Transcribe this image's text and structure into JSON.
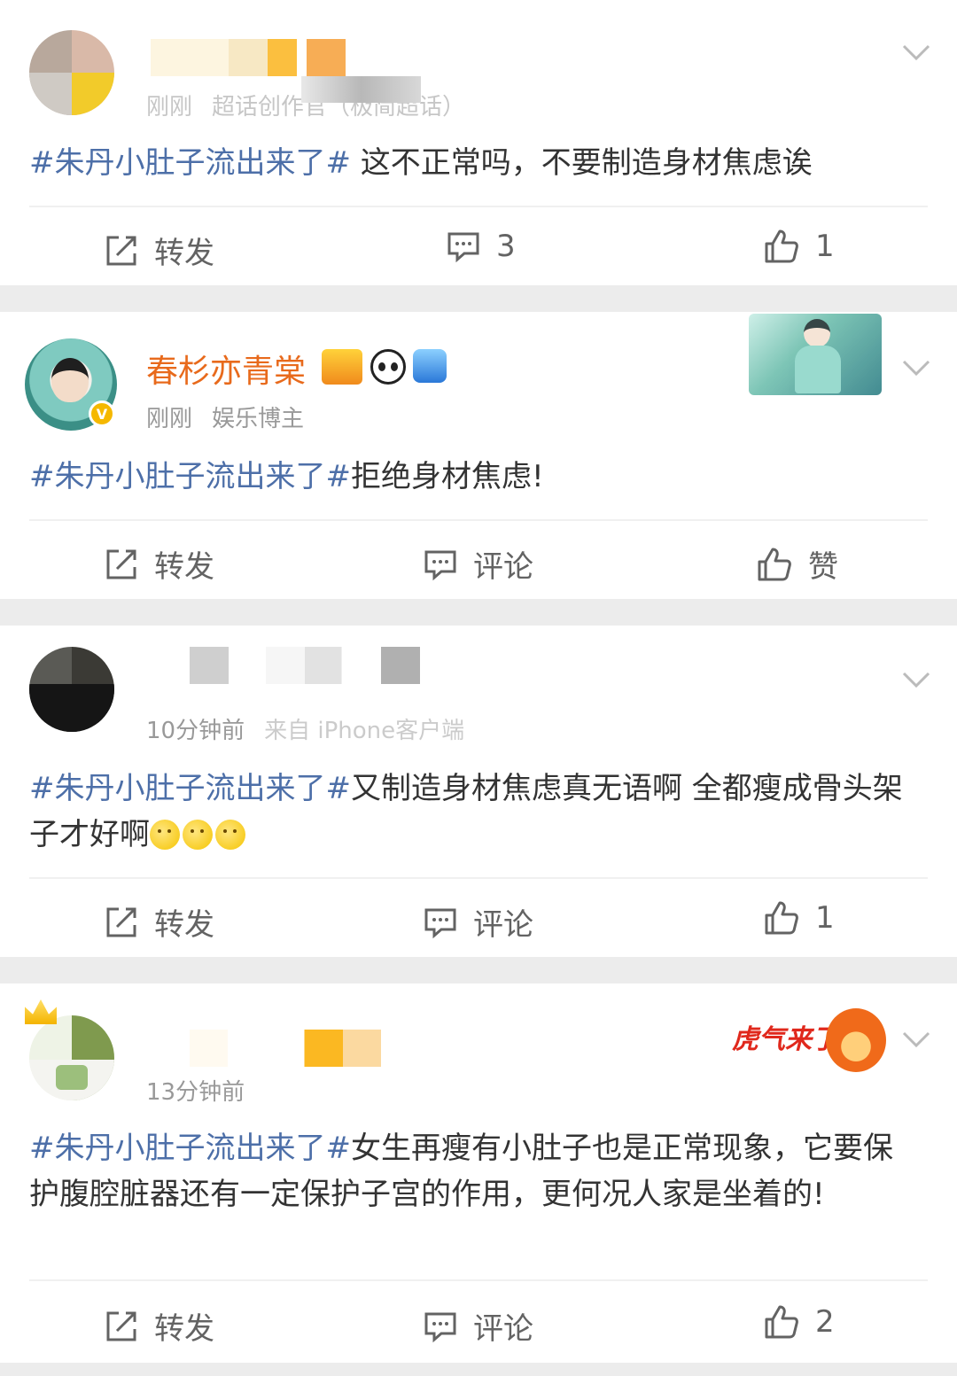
{
  "posts": [
    {
      "time": "刚刚",
      "source": "超话创作官（极简超话）",
      "topic": "#朱丹小肚子流出来了#",
      "text": " 这不正常吗，不要制造身材焦虑诶",
      "repost_label": "转发",
      "comment_label": "3",
      "like_label": "1"
    },
    {
      "username": "春杉亦青棠",
      "time": "刚刚",
      "source": "娱乐博主",
      "topic": "#朱丹小肚子流出来了#",
      "text": "拒绝身材焦虑!",
      "repost_label": "转发",
      "comment_label": "评论",
      "like_label": "赞"
    },
    {
      "time": "10分钟前",
      "source": "来自 iPhone客户端",
      "topic": "#朱丹小肚子流出来了#",
      "text": "又制造身材焦虑真无语啊 全都瘦成骨头架子才好啊",
      "repost_label": "转发",
      "comment_label": "评论",
      "like_label": "1"
    },
    {
      "time": "13分钟前",
      "topic": "#朱丹小肚子流出来了#",
      "text": "女生再瘦有小肚子也是正常现象，它要保护腹腔脏器还有一定保护子宫的作用，更何况人家是坐着的!",
      "repost_label": "转发",
      "comment_label": "评论",
      "like_label": "2",
      "decoration_text": "虎气来了"
    }
  ],
  "colors": {
    "topic": "#4d6fa8",
    "username": "#e86a1c",
    "meta": "#999999",
    "action": "#636363",
    "separator": "#ececec"
  },
  "icons": {
    "repost": "share-edit-icon",
    "comment": "comment-bubble-icon",
    "like": "thumbs-up-icon",
    "more": "chevron-down-icon"
  }
}
